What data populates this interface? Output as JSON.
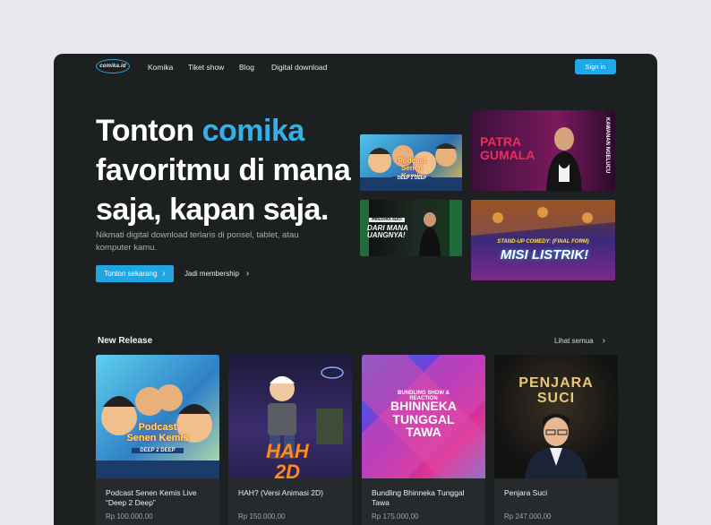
{
  "nav": {
    "logo_text": "comika.id",
    "links": [
      "Komika",
      "Tiket show",
      "Blog",
      "Digital download"
    ],
    "signin": "Sign in"
  },
  "hero": {
    "title_part1": "Tonton ",
    "title_accent": "comika",
    "title_part2": "favoritmu di mana saja, kapan saja.",
    "subtitle": "Nikmati digital download terlaris di ponsel, tablet, atau komputer kamu.",
    "cta_primary": "Tonton sekarang",
    "cta_secondary": "Jadi membership",
    "thumbs": [
      {
        "label": "Podcast Senen Kemis",
        "sub": "DEEP 2 DEEP"
      },
      {
        "label": "PATRA GUMALA",
        "sub": "KAWANAN NGELUCU"
      },
      {
        "label": "DARI MANA UANGNYA!",
        "sub": "PENJARA SUCI"
      },
      {
        "label": "MISI LISTRIK!",
        "sub": "STAND-UP COMEDY: (FINAL FORM)"
      }
    ]
  },
  "new_release": {
    "title": "New Release",
    "see_all": "Lihat semua",
    "items": [
      {
        "name": "Podcast Senen Kemis Live “Deep 2 Deep”",
        "price": "Rp 100.000,00",
        "art": "Podcast Senen Kemis",
        "art_sub": "DEEP 2 DEEP"
      },
      {
        "name": "HAH? (Versi Animasi 2D)",
        "price": "Rp 150.000,00",
        "art": "HAH 2D",
        "art_sub": ""
      },
      {
        "name": "Bundling Bhinneka Tunggal Tawa",
        "price": "Rp 175.000,00",
        "art": "BHINNEKA TUNGGAL TAWA",
        "art_sub": "BUNDLING SHOW & REACTION"
      },
      {
        "name": "Penjara Suci",
        "price": "Rp 247.000,00",
        "art": "PENJARA SUCI",
        "art_sub": ""
      }
    ]
  },
  "colors": {
    "accent": "#21a6e3",
    "background": "#1d2021",
    "card": "#272a2c"
  }
}
